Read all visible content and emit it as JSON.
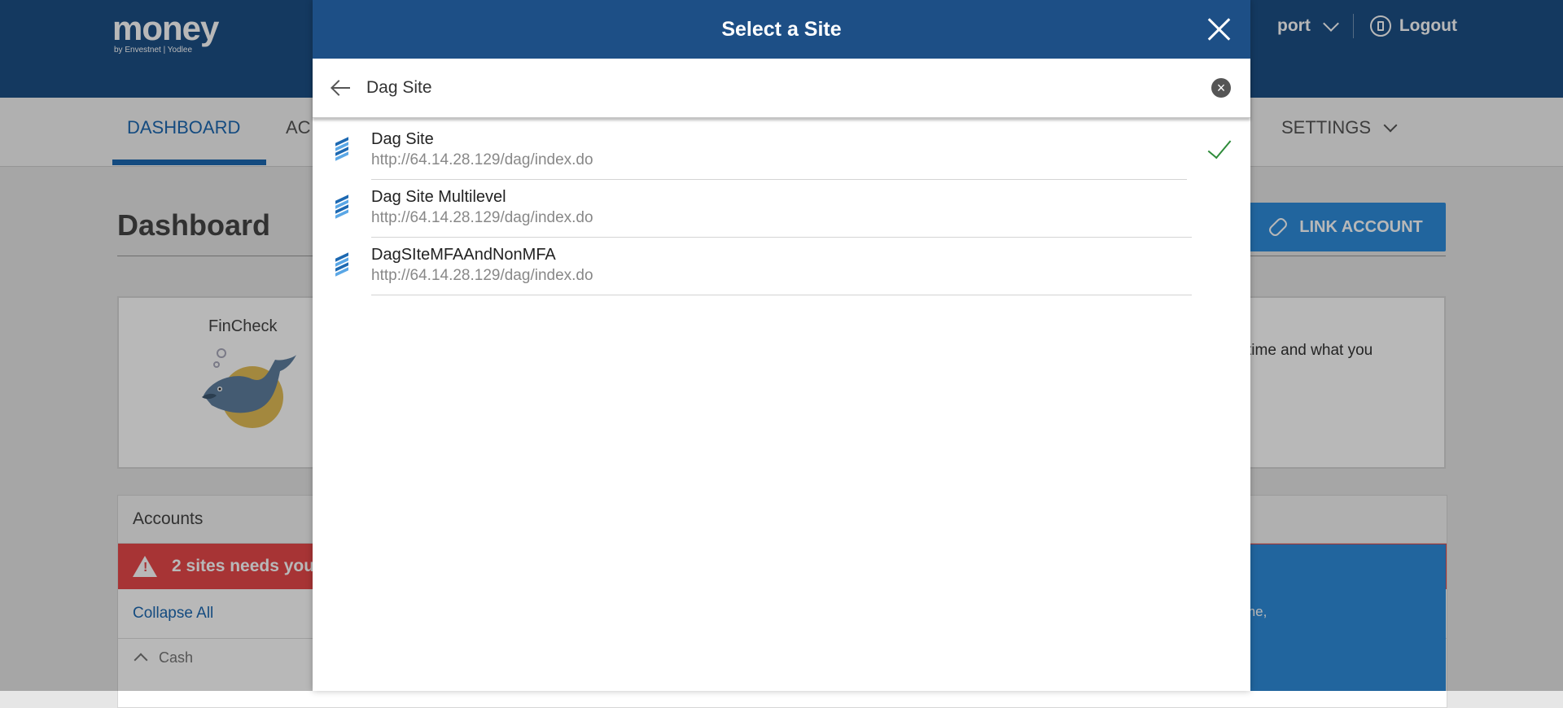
{
  "header": {
    "logo_main": "money",
    "logo_sub": "by Envestnet | Yodlee",
    "support_fragment": "port",
    "logout_label": "Logout"
  },
  "nav": {
    "dashboard": "DASHBOARD",
    "accounts_fragment": "AC",
    "settings": "SETTINGS"
  },
  "page": {
    "title": "Dashboard",
    "link_account": "LINK ACCOUNT"
  },
  "fincheck": {
    "label": "FinCheck",
    "text_fragment": "time and what you"
  },
  "accounts": {
    "header": "Accounts",
    "alert_fragment": "2 sites needs your",
    "collapse_all": "Collapse All",
    "cash": "Cash",
    "side_text_fragment": "me,"
  },
  "modal": {
    "title": "Select a Site",
    "search_value": "Dag Site",
    "results": [
      {
        "name": "Dag Site",
        "url": "http://64.14.28.129/dag/index.do",
        "selected": true
      },
      {
        "name": "Dag Site Multilevel",
        "url": "http://64.14.28.129/dag/index.do",
        "selected": false
      },
      {
        "name": "DagSIteMFAAndNonMFA",
        "url": "http://64.14.28.129/dag/index.do",
        "selected": false
      }
    ]
  },
  "colors": {
    "header_blue": "#1d4f86",
    "accent_blue": "#1d69b2",
    "alert_red": "#e8484a",
    "check_green": "#2e8b3a"
  }
}
